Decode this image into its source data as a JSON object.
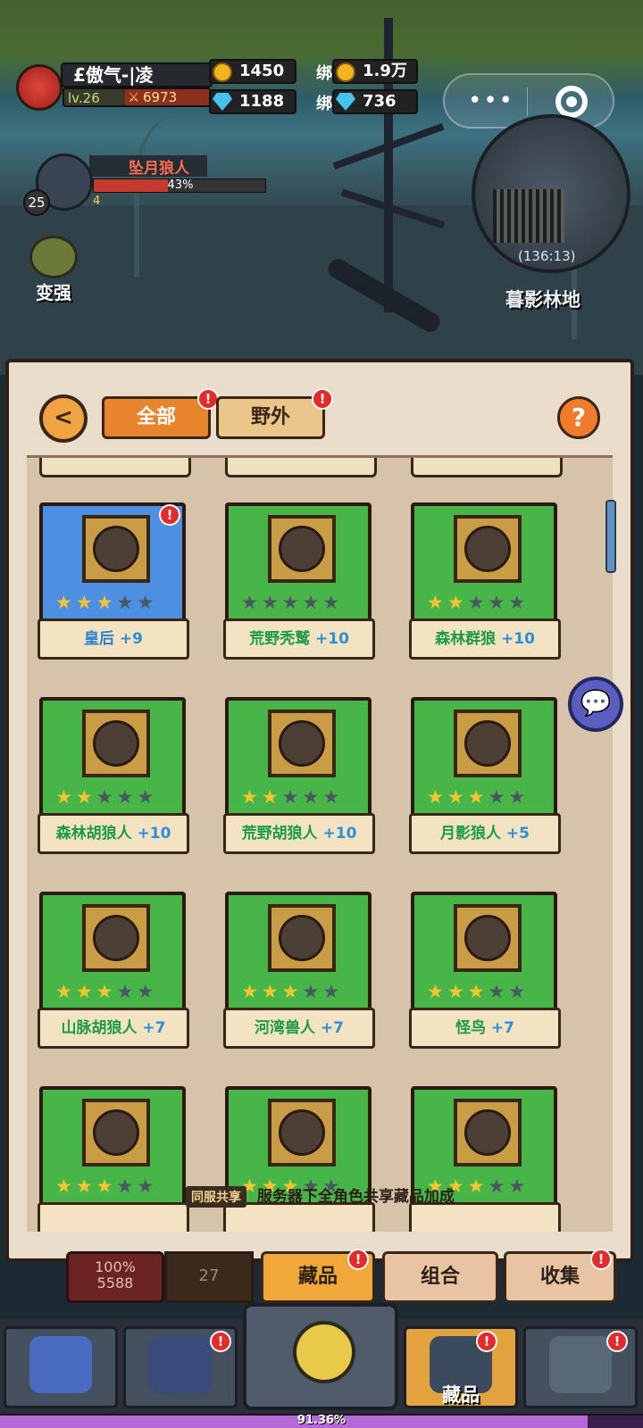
{
  "player": {
    "name": "£傲气-|凌",
    "level": "lv.26",
    "power": "6973"
  },
  "currency": {
    "gold": "1450",
    "diamond": "1188",
    "bind_label": "绑",
    "bound_gold": "1.9万",
    "bound_diamond": "736"
  },
  "capsule": {
    "more": "•••"
  },
  "minimap": {
    "coords": "(136:13)",
    "area_name": "暮影林地"
  },
  "enemy": {
    "name": "坠月狼人",
    "hp_percent": 43,
    "hp_text": "43%",
    "level": "25",
    "count": "4"
  },
  "strengthen": {
    "label": "变强"
  },
  "collection": {
    "tabs": [
      {
        "label": "全部",
        "badge": "!"
      },
      {
        "label": "野外",
        "badge": "!"
      }
    ],
    "help": "?",
    "back": "<",
    "cards": [
      {
        "name": "皇后",
        "plus": "+9",
        "stars": 3,
        "rarity": "blue",
        "badge": "!"
      },
      {
        "name": "荒野秃鹫",
        "plus": "+10",
        "stars": 0,
        "rarity": "green"
      },
      {
        "name": "森林群狼",
        "plus": "+10",
        "stars": 2,
        "rarity": "green"
      },
      {
        "name": "森林胡狼人",
        "plus": "+10",
        "stars": 2,
        "rarity": "green"
      },
      {
        "name": "荒野胡狼人",
        "plus": "+10",
        "stars": 2,
        "rarity": "green"
      },
      {
        "name": "月影狼人",
        "plus": "+5",
        "stars": 3,
        "rarity": "green"
      },
      {
        "name": "山脉胡狼人",
        "plus": "+7",
        "stars": 3,
        "rarity": "green"
      },
      {
        "name": "河湾兽人",
        "plus": "+7",
        "stars": 3,
        "rarity": "green"
      },
      {
        "name": "怪鸟",
        "plus": "+7",
        "stars": 3,
        "rarity": "green"
      },
      {
        "name": "",
        "plus": "",
        "stars": 3,
        "rarity": "green"
      },
      {
        "name": "",
        "plus": "",
        "stars": 3,
        "rarity": "green"
      },
      {
        "name": "",
        "plus": "",
        "stars": 3,
        "rarity": "green"
      }
    ],
    "share_tag": "同服共享",
    "share_text": "服务器下全角色共享藏品加成"
  },
  "subtabs": [
    {
      "label": "藏品",
      "badge": "!"
    },
    {
      "label": "组合"
    },
    {
      "label": "收集",
      "badge": "!"
    }
  ],
  "stats": {
    "percent": "100%",
    "value": "5588",
    "slot": "27"
  },
  "bottom_nav": [
    {
      "icon": "rock-icon"
    },
    {
      "icon": "hooded-mage-icon",
      "badge": "!"
    },
    {
      "icon": "hero-face-icon"
    },
    {
      "icon": "collection-icon",
      "label": "藏品",
      "badge": "!"
    },
    {
      "icon": "castle-icon",
      "badge": "!"
    }
  ],
  "xp": {
    "percent": 91.36,
    "text": "91.36%"
  }
}
